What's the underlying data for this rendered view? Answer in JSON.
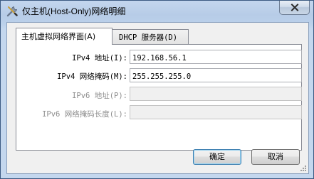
{
  "window": {
    "title": "仅主机(Host-Only)网络明细",
    "close_glyph": "✕"
  },
  "tabs": [
    {
      "label": "主机虚拟网络界面(A)",
      "active": true
    },
    {
      "label": "DHCP 服务器(D)",
      "active": false
    }
  ],
  "form": {
    "ipv4_address": {
      "label": "IPv4 地址(I):",
      "value": "192.168.56.1",
      "enabled": true
    },
    "ipv4_mask": {
      "label": "IPv4 网络掩码(M):",
      "value": "255.255.255.0",
      "enabled": true
    },
    "ipv6_address": {
      "label": "IPv6 地址(P):",
      "value": "",
      "enabled": false
    },
    "ipv6_prefix": {
      "label": "IPv6 网络掩码长度(L):",
      "value": "",
      "enabled": false
    }
  },
  "buttons": {
    "ok": "确定",
    "cancel": "取消"
  },
  "icons": {
    "title": "wrench-screwdriver-icon",
    "close": "close-icon",
    "resize": "resize-grip-icon"
  },
  "colors": {
    "titlebar": "#b9cfe9",
    "default_button_border": "#3c7fb1"
  }
}
